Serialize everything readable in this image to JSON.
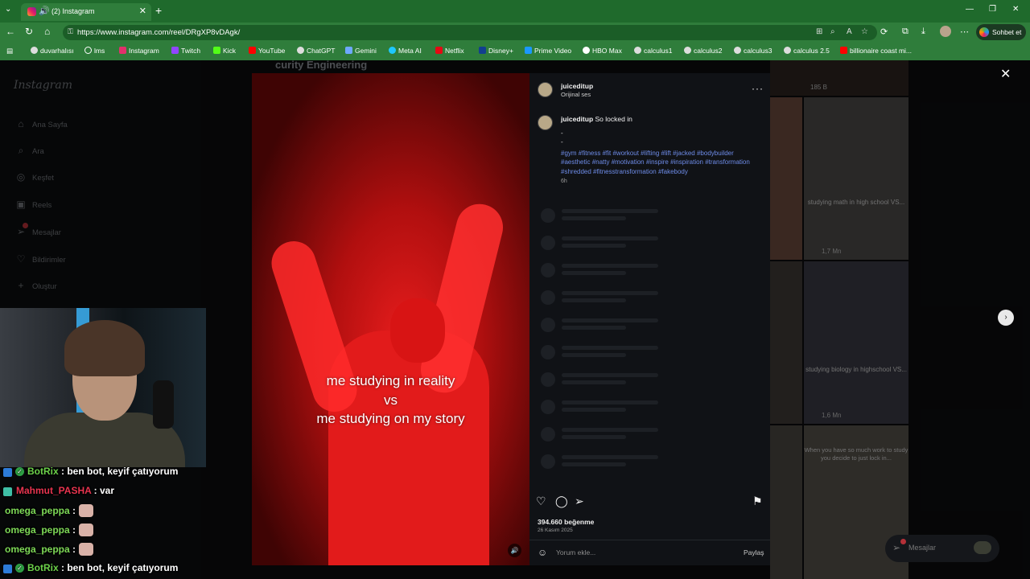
{
  "browser": {
    "tab_title": "(2) Instagram",
    "url": "https://www.instagram.com/reel/DRgXP8vDAgk/",
    "copilot_label": "Sohbet et",
    "bookmarks": [
      "duvarhalısı",
      "lms",
      "Instagram",
      "Twitch",
      "Kick",
      "YouTube",
      "ChatGPT",
      "Gemini",
      "Meta AI",
      "Netflix",
      "Disney+",
      "Prime Video",
      "HBO Max",
      "calculus1",
      "calculus2",
      "calculus3",
      "calculus 2.5",
      "billionaire coast mi..."
    ]
  },
  "sidebar": {
    "logo": "Instagram",
    "items": [
      {
        "label": "Ana Sayfa",
        "icon": "home-icon"
      },
      {
        "label": "Ara",
        "icon": "search-icon"
      },
      {
        "label": "Keşfet",
        "icon": "compass-icon"
      },
      {
        "label": "Reels",
        "icon": "reels-icon"
      },
      {
        "label": "Mesajlar",
        "icon": "messenger-icon"
      },
      {
        "label": "Bildirimler",
        "icon": "heart-icon"
      },
      {
        "label": "Oluştur",
        "icon": "plus-icon"
      }
    ]
  },
  "background": {
    "top_text": "curity Engineering",
    "thumbs": [
      {
        "caption": "",
        "views": "185 B"
      },
      {
        "caption": "studying math in high school VS...",
        "views": "1,7 Mn"
      },
      {
        "caption": "studying biology in highschool VS...",
        "views": "1,6 Mn"
      },
      {
        "caption": "When you have so much work to study you decide to just lock in...",
        "views": ""
      }
    ]
  },
  "reel": {
    "caption_lines": [
      "me studying in reality",
      "vs",
      "me studying on my story"
    ]
  },
  "post": {
    "username": "juiceditup",
    "audio": "Orijinal ses",
    "caption_text": "So locked in",
    "dash": "-",
    "hashtags": "#gym #fitness #fit #workout #lifting #lift #jacked #bodybuilder #aesthetic #natty #motivation #inspire #inspiration #transformation #shredded #fitnesstransformation #fakebody",
    "time": "6h",
    "likes": "394.660 beğenme",
    "date": "26 Kasım 2025",
    "comment_placeholder": "Yorum ekle...",
    "share_label": "Paylaş"
  },
  "float_messages": "Mesajlar",
  "chat": [
    {
      "user": "BotRix",
      "message": " : ben bot, keyif çatıyorum",
      "color": "#6cd14a"
    },
    {
      "user": "Mahmut_PASHA",
      "message": " : var",
      "color": "#e8344f"
    },
    {
      "user": "omega_peppa",
      "message": " :",
      "color": "#7ed957"
    },
    {
      "user": "omega_peppa",
      "message": " :",
      "color": "#7ed957"
    },
    {
      "user": "omega_peppa",
      "message": " :",
      "color": "#7ed957"
    },
    {
      "user": "BotRix",
      "message": " : ben bot, keyif çatıyorum",
      "color": "#6cd14a"
    }
  ]
}
